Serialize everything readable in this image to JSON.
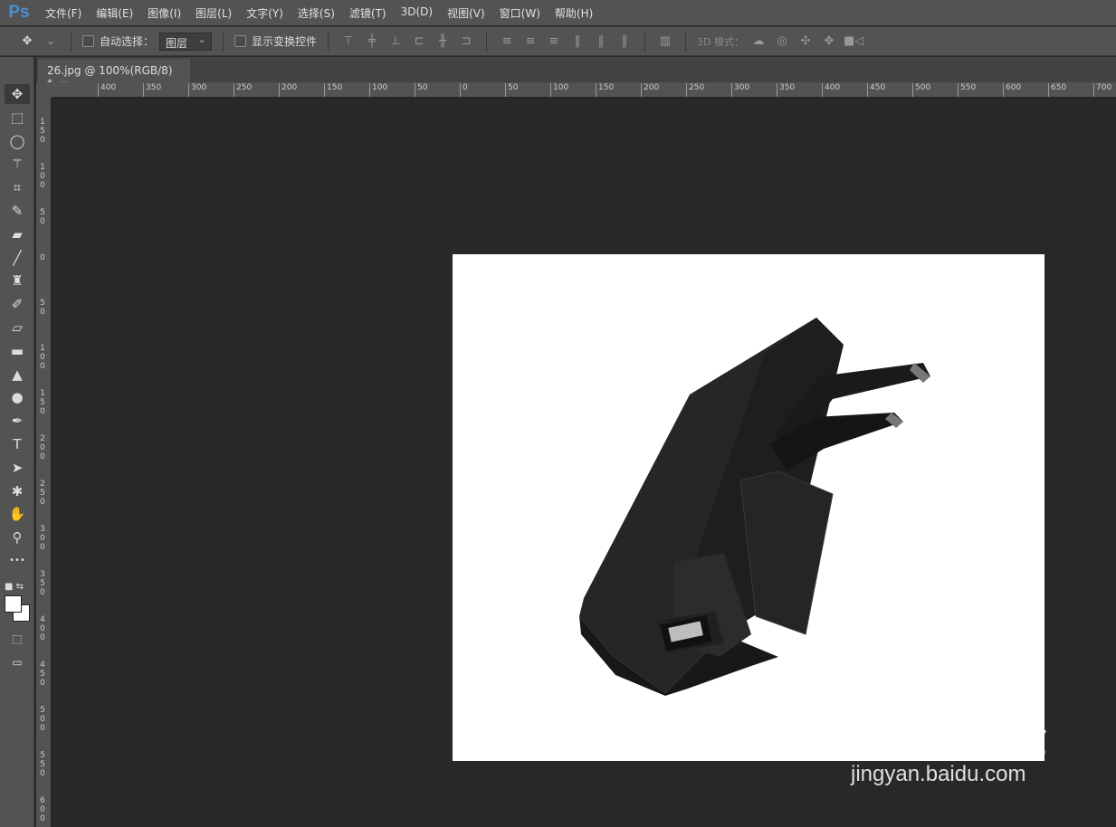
{
  "app": {
    "logo": "Ps"
  },
  "menu": [
    "文件(F)",
    "编辑(E)",
    "图像(I)",
    "图层(L)",
    "文字(Y)",
    "选择(S)",
    "滤镜(T)",
    "3D(D)",
    "视图(V)",
    "窗口(W)",
    "帮助(H)"
  ],
  "options": {
    "auto_select_label": "自动选择：",
    "auto_select_value": "图层",
    "show_transform_label": "显示变换控件",
    "mode3d_label": "3D 模式："
  },
  "document_tab": {
    "title": "26.jpg @ 100%(RGB/8) *",
    "close": "×"
  },
  "ruler_h": [
    "400",
    "350",
    "300",
    "250",
    "200",
    "150",
    "100",
    "50",
    "0",
    "50",
    "100",
    "150",
    "200",
    "250",
    "300",
    "350",
    "400",
    "450",
    "500",
    "550",
    "600",
    "650",
    "700"
  ],
  "ruler_v": [
    "150",
    "100",
    "50",
    "0",
    "50",
    "100",
    "150",
    "200",
    "250",
    "300",
    "350",
    "400",
    "450",
    "500",
    "550",
    "600"
  ],
  "tools": [
    "move-icon",
    "marquee-icon",
    "lasso-icon",
    "magic-wand-icon",
    "crop-icon",
    "eyedropper-icon",
    "healing-brush-icon",
    "brush-icon",
    "clone-stamp-icon",
    "history-brush-icon",
    "eraser-icon",
    "gradient-icon",
    "blur-icon",
    "dodge-icon",
    "pen-icon",
    "type-icon",
    "path-selection-icon",
    "shape-icon",
    "hand-icon",
    "zoom-icon",
    "more-icon"
  ],
  "colors": {
    "foreground": "#ffffff",
    "background": "#ffffff",
    "accent": "#4a90d0"
  },
  "watermark": {
    "brand": "Baidu经验",
    "url": "jingyan.baidu.com"
  }
}
